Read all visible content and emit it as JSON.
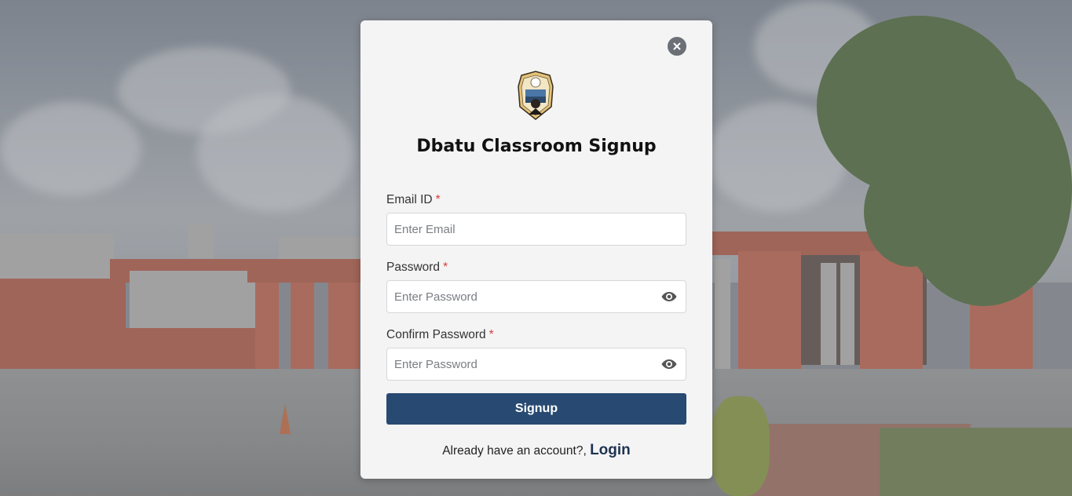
{
  "modal": {
    "title": "Dbatu Classroom Signup",
    "close_icon": "close-icon",
    "logo_icon": "university-crest-logo"
  },
  "form": {
    "email": {
      "label": "Email ID",
      "required_mark": "*",
      "placeholder": "Enter Email",
      "value": ""
    },
    "password": {
      "label": "Password",
      "required_mark": "*",
      "placeholder": "Enter Password",
      "value": "",
      "toggle_icon": "eye-icon"
    },
    "confirm_password": {
      "label": "Confirm Password",
      "required_mark": "*",
      "placeholder": "Enter Password",
      "value": "",
      "toggle_icon": "eye-icon"
    },
    "submit_label": "Signup"
  },
  "footer": {
    "prompt": "Already have an account?,",
    "login_label": "Login"
  },
  "colors": {
    "primary_button": "#284a72",
    "required": "#d93b3b",
    "login_link": "#1f3350"
  }
}
